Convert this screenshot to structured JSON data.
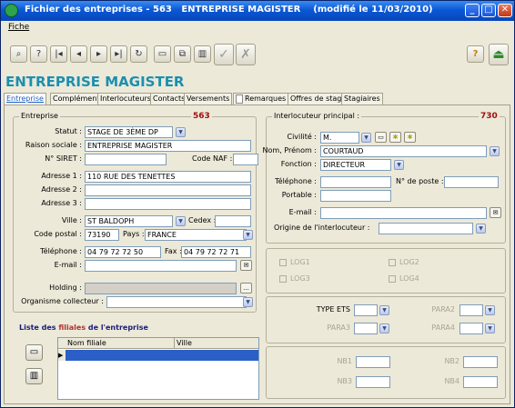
{
  "window": {
    "title": "Fichier des entreprises - 563   ENTREPRISE MAGISTER    (modifié le 11/03/2010)"
  },
  "menu": {
    "fiche": "Fiche"
  },
  "toolbar": {
    "buttons": [
      "binoculars-icon",
      "help-icon",
      "first-record-icon",
      "prev-record-icon",
      "next-record-icon",
      "last-record-icon",
      "refresh-icon",
      "new-document-icon",
      "copy-icon",
      "delete-icon",
      "validate-icon",
      "cancel-icon"
    ],
    "help_label": "?"
  },
  "page_heading": "ENTREPRISE MAGISTER",
  "tabs": [
    "Entreprise",
    "Complément",
    "Interlocuteurs",
    "Contacts",
    "Versements",
    "Remarques",
    "Offres de stage",
    "Stagiaires"
  ],
  "entreprise": {
    "group_title": "Entreprise",
    "id": "563",
    "statut_label": "Statut :",
    "statut_value": "STAGE DE 3ÈME DP",
    "raison_label": "Raison sociale :",
    "raison_value": "ENTREPRISE MAGISTER",
    "siret_label": "N° SIRET :",
    "siret_value": "",
    "naf_label": "Code NAF :",
    "naf_value": "",
    "adr1_label": "Adresse 1 :",
    "adr1_value": "110 RUE DES TENETTES",
    "adr2_label": "Adresse 2 :",
    "adr2_value": "",
    "adr3_label": "Adresse 3 :",
    "adr3_value": "",
    "ville_label": "Ville :",
    "ville_value": "ST BALDOPH",
    "cedex_label": "Cedex :",
    "cedex_value": "",
    "cp_label": "Code postal :",
    "cp_value": "73190",
    "pays_label": "Pays :",
    "pays_value": "FRANCE",
    "tel_label": "Téléphone :",
    "tel_value": "04 79 72 72 50",
    "fax_label": "Fax :",
    "fax_value": "04 79 72 72 71",
    "email_label": "E-mail :",
    "email_value": "",
    "holding_label": "Holding :",
    "holding_value": "",
    "org_label": "Organisme collecteur :",
    "org_value": ""
  },
  "filiales": {
    "title_prefix": "Liste des ",
    "title_highlight": "filiales",
    "title_suffix": " de l'entreprise",
    "columns": [
      "Nom filiale",
      "Ville"
    ]
  },
  "interlocuteur": {
    "group_title": "Interlocuteur principal :",
    "id": "730",
    "civilite_label": "Civilité :",
    "civilite_value": "M.",
    "nom_label": "Nom, Prénom :",
    "nom_value": "COURTAUD",
    "fonction_label": "Fonction :",
    "fonction_value": "DIRECTEUR",
    "tel_label": "Téléphone :",
    "tel_value": "",
    "poste_label": "N° de poste :",
    "poste_value": "",
    "portable_label": "Portable :",
    "portable_value": "",
    "email_label": "E-mail :",
    "email_value": "",
    "origine_label": "Origine de l'interlocuteur :",
    "origine_value": ""
  },
  "logs": [
    "LOG1",
    "LOG2",
    "LOG3",
    "LOG4"
  ],
  "params": {
    "type_ets": "TYPE ETS",
    "para2": "PARA2",
    "para3": "PARA3",
    "para4": "PARA4",
    "nb1": "NB1",
    "nb2": "NB2",
    "nb3": "NB3",
    "nb4": "NB4"
  },
  "colors": {
    "titlebar": "#0a58d6",
    "heading": "#1c8fb0",
    "id_red": "#a01010",
    "selection": "#2a5fc7"
  }
}
